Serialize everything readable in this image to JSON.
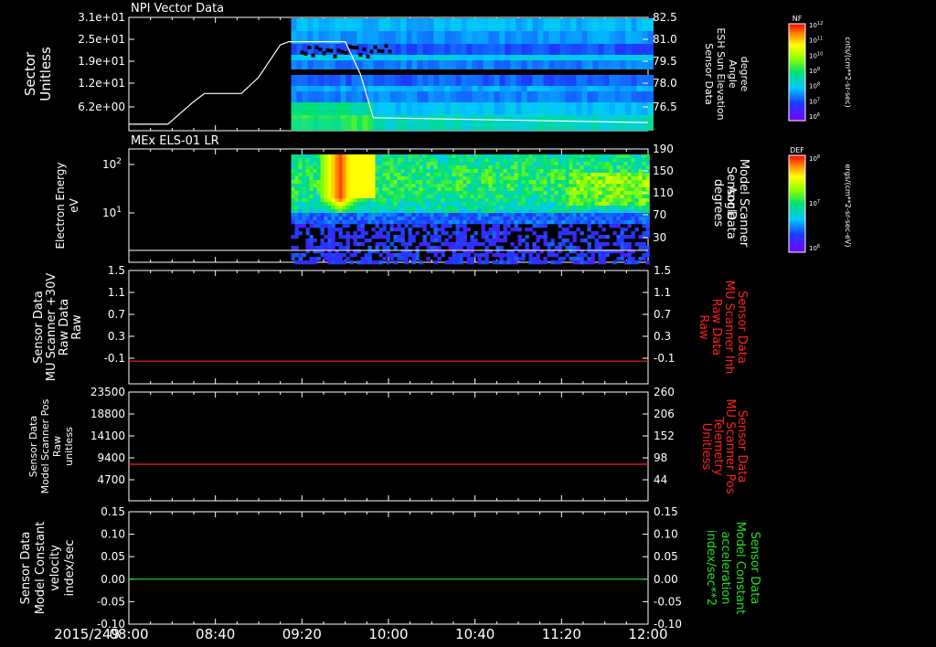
{
  "date_label": "2015/249",
  "time_ticks": [
    "08:00",
    "08:40",
    "09:20",
    "10:00",
    "10:40",
    "11:20",
    "12:00"
  ],
  "colors": {
    "background": "#000000",
    "axis": "#ffffff",
    "red_trace": "#ff2020",
    "green_trace": "#20e020"
  },
  "chart_data": [
    {
      "type": "heatmap",
      "title": "NPI Vector Data",
      "xlabel": "",
      "ylabel_lines": [
        "Sector",
        "Unitless"
      ],
      "yticks": [
        "3.1e+01",
        "2.5e+01",
        "1.9e+01",
        "1.2e+01",
        "6.2e+00"
      ],
      "y2label_lines": [
        "Sensor Data",
        "ESH Sun Elevation",
        "Angle",
        "degree"
      ],
      "y2ticks": [
        "82.5",
        "81.0",
        "79.5",
        "78.0",
        "76.5"
      ],
      "data_start": "09:15",
      "overlay_line": {
        "name": "ESH Sun Elevation Angle",
        "points": [
          [
            "08:00",
            75.9
          ],
          [
            "08:18",
            75.9
          ],
          [
            "08:30",
            77.3
          ],
          [
            "08:35",
            77.8
          ],
          [
            "08:52",
            77.8
          ],
          [
            "09:00",
            78.8
          ],
          [
            "09:10",
            80.8
          ],
          [
            "09:14",
            81.0
          ],
          [
            "09:40",
            81.0
          ],
          [
            "09:47",
            79.0
          ],
          [
            "09:53",
            76.3
          ],
          [
            "12:00",
            76.0
          ]
        ]
      },
      "colorbar": {
        "title": "NF",
        "ticks": [
          "10^12",
          "10^11",
          "10^10",
          "10^9",
          "10^8",
          "10^7",
          "10^6"
        ],
        "units": "cnts/(cm**2-sr-sec)"
      }
    },
    {
      "type": "heatmap",
      "title": "MEx ELS-01 LR",
      "xlabel": "",
      "ylabel_lines": [
        "Electron Energy",
        "eV"
      ],
      "yticks": [
        "10^2",
        "10^1"
      ],
      "yscale": "log",
      "y2label_lines": [
        "Sensor Data",
        "Model Scanner",
        "Angle",
        "degrees"
      ],
      "y2ticks": [
        "190",
        "150",
        "110",
        "70",
        "30"
      ],
      "data_start": "09:15",
      "overlay_line": {
        "name": "Model Scanner Angle",
        "points": [
          [
            "08:00",
            13
          ],
          [
            "12:00",
            13
          ]
        ]
      },
      "colorbar": {
        "title": "DEF",
        "ticks": [
          "10^8",
          "10^7",
          "10^6"
        ],
        "units": "ergs/(cm**2-sr-sec-eV)"
      }
    },
    {
      "type": "line",
      "ylabel_lines": [
        "Sensor Data",
        "MU Scanner +30V",
        "Raw Data",
        "Raw"
      ],
      "yticks": [
        "1.5",
        "1.1",
        "0.7",
        "0.3",
        "-0.1"
      ],
      "ylim": [
        -0.35,
        1.5
      ],
      "y2label_lines": [
        "Sensor Data",
        "MU Scanner Inh",
        "Raw Data",
        "Raw"
      ],
      "y2ticks": [
        "1.5",
        "1.1",
        "0.7",
        "0.3",
        "-0.1"
      ],
      "series": [
        {
          "values": [
            [
              0,
              0.02
            ],
            [
              240,
              0.02
            ]
          ],
          "color": "#ff2020"
        }
      ]
    },
    {
      "type": "line",
      "ylabel_lines": [
        "Sensor Data",
        "Model Scanner Pos",
        "Raw",
        "unitless"
      ],
      "yticks": [
        "23500",
        "18800",
        "14100",
        "9400",
        "4700"
      ],
      "ylim": [
        0,
        23500
      ],
      "y2label_lines": [
        "Sensor Data",
        "MU Scanner Pos",
        "Telemetry",
        "Unitless"
      ],
      "y2ticks": [
        "260",
        "206",
        "152",
        "98",
        "44"
      ],
      "series": [
        {
          "values": [
            [
              0,
              7900
            ],
            [
              240,
              7900
            ]
          ],
          "color": "#ff2020"
        }
      ]
    },
    {
      "type": "line",
      "ylabel_lines": [
        "Sensor Data",
        "Model Constant",
        "velocity",
        "index/sec"
      ],
      "yticks": [
        "0.15",
        "0.10",
        "0.05",
        "0.00",
        "-0.05",
        "-0.10"
      ],
      "ylim": [
        -0.1,
        0.15
      ],
      "y2label_lines": [
        "Sensor Data",
        "Model Constant",
        "acceleration",
        "index/sec**2"
      ],
      "y2ticks": [
        "0.15",
        "0.10",
        "0.05",
        "0.00",
        "-0.05",
        "-0.10"
      ],
      "series": [
        {
          "values": [
            [
              0,
              0.0
            ],
            [
              240,
              0.0
            ]
          ],
          "color": "#20e020"
        }
      ]
    }
  ]
}
